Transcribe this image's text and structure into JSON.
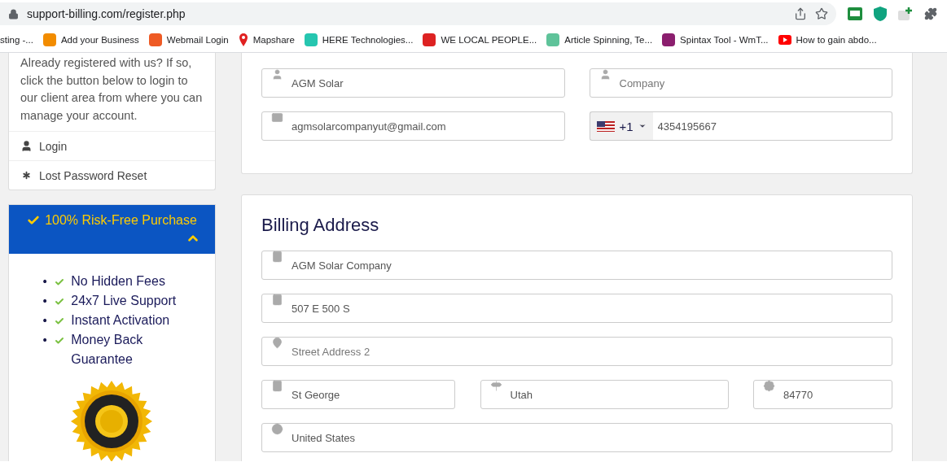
{
  "browser": {
    "url": "support-billing.com/register.php",
    "bookmarks": [
      "sting -...",
      "Add your Business",
      "Webmail Login",
      "Mapshare",
      "HERE Technologies...",
      "WE LOCAL PEOPLE...",
      "Article Spinning, Te...",
      "Spintax Tool - WmT...",
      "How to gain abdo..."
    ]
  },
  "sidebar": {
    "intro": "Already registered with us? If so, click the button below to login to our client area from where you can manage your account.",
    "links": [
      {
        "kind": "account",
        "label": "Login"
      },
      {
        "kind": "reset",
        "label": "Lost Password Reset"
      }
    ],
    "promo": {
      "title": "100% Risk-Free Purchase",
      "expanded": true,
      "items": [
        {
          "bullet": "•",
          "text": "No Hidden Fees"
        },
        {
          "bullet": "•",
          "text": "24x7 Live Support"
        },
        {
          "bullet": "•",
          "text": "Instant Activation"
        },
        {
          "bullet": "•",
          "text": "Money Back Guarantee"
        }
      ]
    }
  },
  "contact": {
    "fields": [
      {
        "kind": "person",
        "value": "AGM Solar"
      },
      {
        "kind": "person",
        "placeholder": "Company"
      },
      {
        "kind": "email",
        "value": "agmsolarcompanyut@gmail.com"
      },
      {
        "kind": "phone",
        "country_code": "+1",
        "value": "4354195667"
      }
    ]
  },
  "billing": {
    "title": "Billing Address",
    "rows": [
      [
        {
          "kind": "company",
          "value": "AGM Solar Company"
        }
      ],
      [
        {
          "kind": "company",
          "value": "507 E 500 S"
        }
      ],
      [
        {
          "kind": "location",
          "placeholder": "Street Address 2"
        }
      ],
      [
        {
          "kind": "company",
          "value": "St George"
        },
        {
          "kind": "region",
          "value": "Utah"
        },
        {
          "kind": "postal",
          "value": "84770"
        }
      ],
      [
        {
          "kind": "country",
          "value": "United States"
        }
      ]
    ]
  }
}
